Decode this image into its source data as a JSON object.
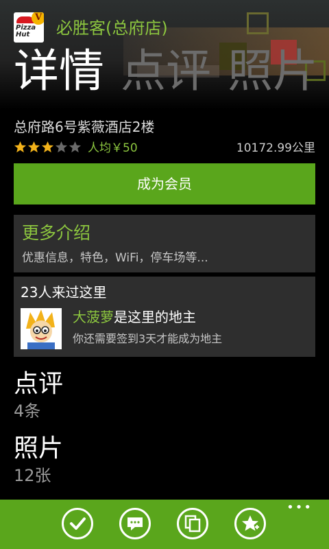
{
  "header": {
    "app_title": "必胜客(总府店)",
    "logo_text": "Pizza Hut",
    "logo_badge": "V",
    "pivot": [
      {
        "label": "详情",
        "active": true
      },
      {
        "label": "点评",
        "active": false
      },
      {
        "label": "照片",
        "active": false
      }
    ]
  },
  "details": {
    "address": "总府路6号紫薇酒店2楼",
    "rating_stars": 3,
    "rating_max": 5,
    "avg_price": "人均￥50",
    "distance": "10172.99公里"
  },
  "member_button": "成为会员",
  "intro": {
    "title": "更多介绍",
    "subtitle": "优惠信息，特色，WiFi，停车场等..."
  },
  "visited": {
    "count_text": "23人来过这里",
    "owner_name": "大菠萝",
    "owner_suffix": "是这里的地主",
    "hint": "你还需要签到3天才能成为地主"
  },
  "reviews": {
    "title": "点评",
    "count": "4条"
  },
  "photos": {
    "title": "照片",
    "count": "12张"
  },
  "appbar": {
    "more": "•••",
    "buttons": [
      "check-in-icon",
      "comment-icon",
      "copy-icon",
      "favorite-icon"
    ]
  },
  "colors": {
    "accent": "#5aa61c",
    "accent_text": "#8cc63f",
    "panel": "#2e2e2e"
  }
}
